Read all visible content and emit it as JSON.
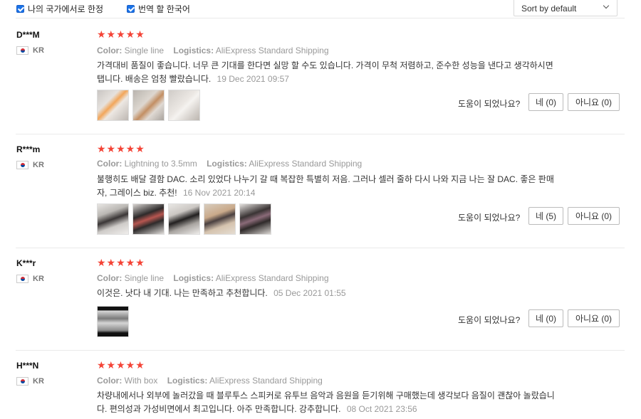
{
  "filters": {
    "own_country": "나의 국가에서로 한정",
    "translate": "번역 할 한국어",
    "sort": "Sort by default"
  },
  "labels": {
    "color": "Color:",
    "logistics": "Logistics:",
    "helpful": "도움이 되었나요?"
  },
  "reviews": [
    {
      "user": "D***M",
      "country": "KR",
      "stars": "★★★★★",
      "color": "Single line",
      "logistics": "AliExpress Standard Shipping",
      "text": "가격대비 품질이 좋습니다. 너무 큰 기대를 한다면 실망 할 수도 있습니다. 가격이 무척 저렴하고, 준수한 성능을 낸다고 생각하시면 탭니다. 배송은 엄청 빨랐습니다.",
      "date": "19 Dec 2021 09:57",
      "yes": "네 (0)",
      "no": "아니요 (0)"
    },
    {
      "user": "R***m",
      "country": "KR",
      "stars": "★★★★★",
      "color": "Lightning to 3.5mm",
      "logistics": "AliExpress Standard Shipping",
      "text": "불행히도 배달 결함 DAC. 소리 있었다 나누기 갈 때 복잡한 특별히 저음. 그러나 셀러 줄하 다시 나와 지금 나는 잘 DAC. 좋은 판매자, 그레이스 biz. 추천!",
      "date": "16 Nov 2021 20:14",
      "yes": "네 (5)",
      "no": "아니요 (0)"
    },
    {
      "user": "K***r",
      "country": "KR",
      "stars": "★★★★★",
      "color": "Single line",
      "logistics": "AliExpress Standard Shipping",
      "text": "이것은. 낫다 내 기대. 나는 만족하고 추천합니다.",
      "date": "05 Dec 2021 01:55",
      "yes": "네 (0)",
      "no": "아니요 (0)"
    },
    {
      "user": "H***N",
      "country": "KR",
      "stars": "★★★★★",
      "color": "With box",
      "logistics": "AliExpress Standard Shipping",
      "text": "차량내에서나 외부에 놀러갔을 때 블루투스 스피커로 유투브 음악과 음원을 듣기위해 구매했는데 생각보다 음질이 괜찮아 놀랐습니다. 편의성과 가성비면에서 최고입니다. 아주 만족합니다. 강추합니다.",
      "date": "08 Oct 2021 23:56"
    }
  ],
  "colors": {
    "star": "#f44336",
    "checkbox": "#1a73e8"
  }
}
